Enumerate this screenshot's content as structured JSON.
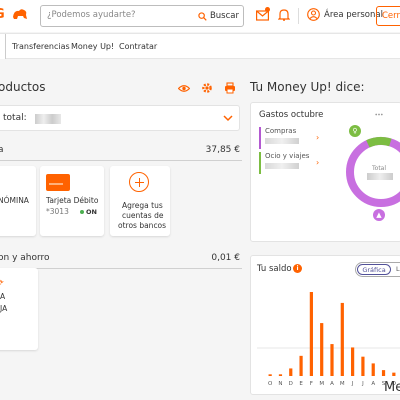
{
  "header": {
    "logo_text": "G",
    "search_placeholder": "¿Podemos ayudarte?",
    "search_button": "Buscar",
    "user_label": "Área personal",
    "logout_label": "Cerrar"
  },
  "nav": {
    "items": [
      "Transferencias",
      "Money Up!",
      "Contratar"
    ]
  },
  "products": {
    "title": "oductos",
    "total_label": "total:",
    "section1_title": "a",
    "section1_amount": "37,85 €",
    "card1_line1": "NÓMINA",
    "card2_line1": "Tarjeta Débito",
    "card2_number": "*3013",
    "card2_status": "ON",
    "card3_line1": "Agrega tus",
    "card3_line2": "cuentas de",
    "card3_line3": "otros bancos",
    "section2_title": "on y ahorro",
    "section2_amount": "0,01 €",
    "savings_line1": "A",
    "savings_line2": "JA"
  },
  "moneyup": {
    "title": "Tu Money Up! dice:",
    "gastos_title": "Gastos octubre",
    "categories": [
      {
        "name": "Compras",
        "color": "#b35ad1"
      },
      {
        "name": "Ocio y viajes",
        "color": "#7cbd42"
      }
    ],
    "donut_label": "Total",
    "donut_segments": [
      {
        "name": "Compras",
        "fraction": 0.88,
        "color": "#c86fe0"
      },
      {
        "name": "Ocio y viajes",
        "fraction": 0.12,
        "color": "#7cbd42"
      }
    ]
  },
  "saldo": {
    "title": "Tu saldo",
    "info": "i",
    "toggle_active": "Gráfica",
    "toggle_inactive": "L",
    "bottom_text": "Me"
  },
  "chart_data": {
    "type": "bar",
    "categories": [
      "O",
      "N",
      "D",
      "E",
      "F",
      "M",
      "A",
      "M",
      "J",
      "J",
      "A",
      "S",
      "O"
    ],
    "values": [
      0.02,
      0.02,
      0.09,
      0.24,
      1.0,
      0.63,
      0.38,
      0.87,
      0.34,
      0.23,
      0.15,
      0.07,
      0.04
    ],
    "color": "#ff6200",
    "title": "",
    "xlabel": "",
    "ylabel": ""
  }
}
